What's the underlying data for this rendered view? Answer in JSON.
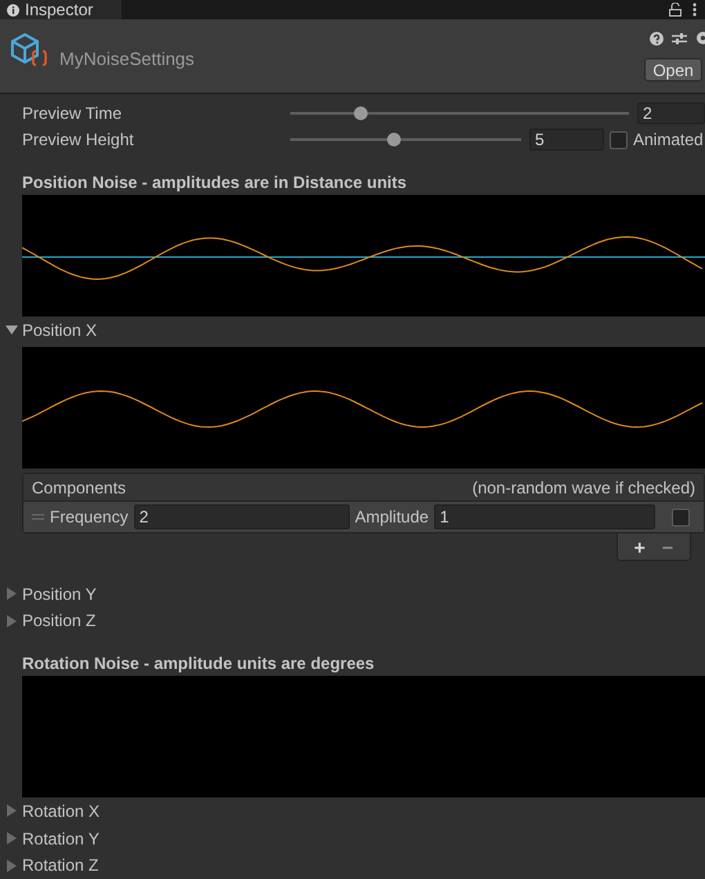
{
  "tab": {
    "title": "Inspector"
  },
  "asset": {
    "name": "MyNoiseSettings",
    "open_button": "Open"
  },
  "preview": [
    {
      "label": "Preview Time",
      "level": 0.21,
      "value": "2"
    },
    {
      "label": "Preview Height",
      "level": 0.45,
      "value": "5",
      "toggle": {
        "label": "Animated",
        "checked": false
      }
    }
  ],
  "sections": [
    {
      "heading": "Position Noise - amplitudes are in Distance units",
      "graph": {
        "kind": "waves"
      },
      "foldouts": [
        {
          "label": "Position X",
          "expanded": true,
          "components": {
            "title": "Components",
            "hint": "(non-random wave if checked)",
            "rows": [
              {
                "frequency_label": "Frequency",
                "frequency": "2",
                "amplitude_label": "Amplitude",
                "amplitude": "1",
                "checked": false
              }
            ],
            "buttons": [
              "+",
              "−"
            ]
          }
        },
        {
          "label": "Position Y",
          "expanded": false
        },
        {
          "label": "Position Z",
          "expanded": false
        }
      ]
    },
    {
      "heading": "Rotation Noise - amplitude units are degrees",
      "graph": {
        "kind": "empty"
      },
      "foldouts": [
        {
          "label": "Rotation X",
          "expanded": false
        },
        {
          "label": "Rotation Y",
          "expanded": false
        },
        {
          "label": "Rotation Z",
          "expanded": false
        }
      ]
    }
  ]
}
